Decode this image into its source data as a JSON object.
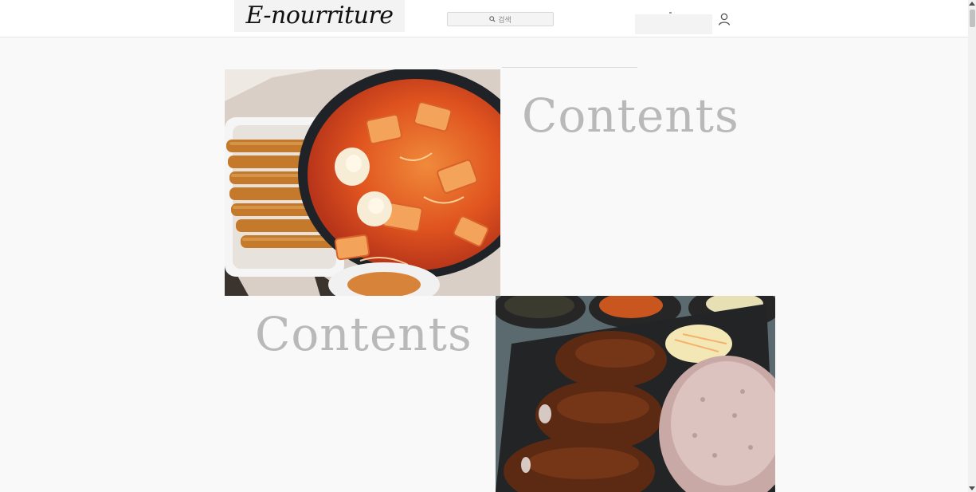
{
  "header": {
    "logo_text": "E-nourriture",
    "search": {
      "label": "검색",
      "icon": "search-icon"
    },
    "user_icon": "user-icon"
  },
  "main": {
    "sections": [
      {
        "image": "tteokbokki-food-photo",
        "heading": "Contents"
      },
      {
        "image": "pork-cutlet-rice-photo",
        "heading": "Contents"
      }
    ]
  },
  "colors": {
    "background": "#f9f9f9",
    "header": "#ffffff",
    "heading_text": "#b9b9b9"
  }
}
